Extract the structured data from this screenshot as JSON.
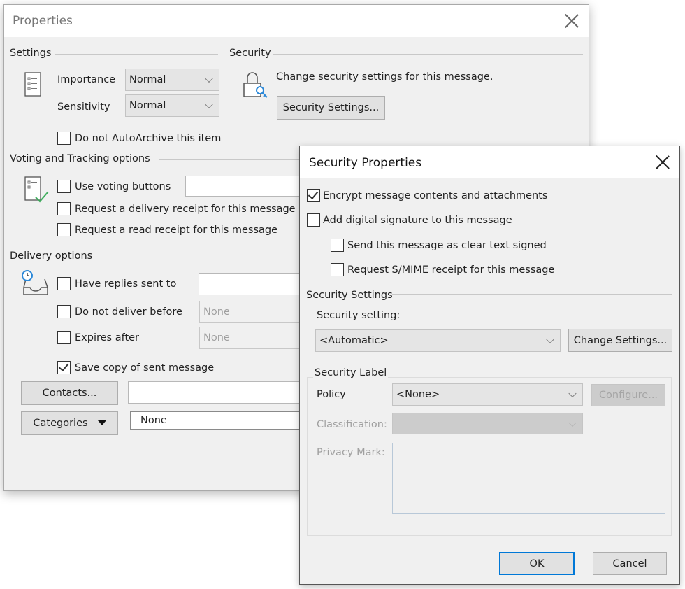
{
  "properties_window": {
    "title": "Properties",
    "settings": {
      "header": "Settings",
      "importance_label": "Importance",
      "importance_value": "Normal",
      "sensitivity_label": "Sensitivity",
      "sensitivity_value": "Normal",
      "do_not_autoarchive": {
        "label": "Do not AutoArchive this item",
        "checked": false
      }
    },
    "security": {
      "header": "Security",
      "description": "Change security settings for this message.",
      "button_label": "Security Settings..."
    },
    "voting": {
      "header": "Voting and Tracking options",
      "use_voting_buttons": {
        "label": "Use voting buttons",
        "checked": false,
        "value": ""
      },
      "delivery_receipt": {
        "label": "Request a delivery receipt for this message",
        "checked": false
      },
      "read_receipt": {
        "label": "Request a read receipt for this message",
        "checked": false
      }
    },
    "delivery": {
      "header": "Delivery options",
      "have_replies_sent_to": {
        "label": "Have replies sent to",
        "checked": false,
        "value": ""
      },
      "do_not_deliver_before": {
        "label": "Do not deliver before",
        "checked": false,
        "value": "None"
      },
      "expires_after": {
        "label": "Expires after",
        "checked": false,
        "value": "None"
      },
      "save_copy": {
        "label": "Save copy of sent message",
        "checked": true
      }
    },
    "contacts_button": "Contacts...",
    "contacts_value": "",
    "categories_button": "Categories",
    "categories_value": "None"
  },
  "security_properties": {
    "title": "Security Properties",
    "encrypt": {
      "label": "Encrypt message contents and attachments",
      "checked": true
    },
    "digital_signature": {
      "label": "Add digital signature to this message",
      "checked": false
    },
    "clear_text_signed": {
      "label": "Send this message as clear text signed",
      "checked": false
    },
    "smime_receipt": {
      "label": "Request S/MIME receipt for this message",
      "checked": false
    },
    "security_settings_header": "Security Settings",
    "security_setting_label": "Security setting:",
    "security_setting_value": "<Automatic>",
    "change_settings_button": "Change Settings...",
    "security_label_header": "Security Label",
    "policy_label": "Policy",
    "policy_value": "<None>",
    "configure_button": "Configure...",
    "classification_label": "Classification:",
    "classification_value": "",
    "privacy_mark_label": "Privacy Mark:",
    "privacy_mark_value": "",
    "ok_button": "OK",
    "cancel_button": "Cancel"
  }
}
